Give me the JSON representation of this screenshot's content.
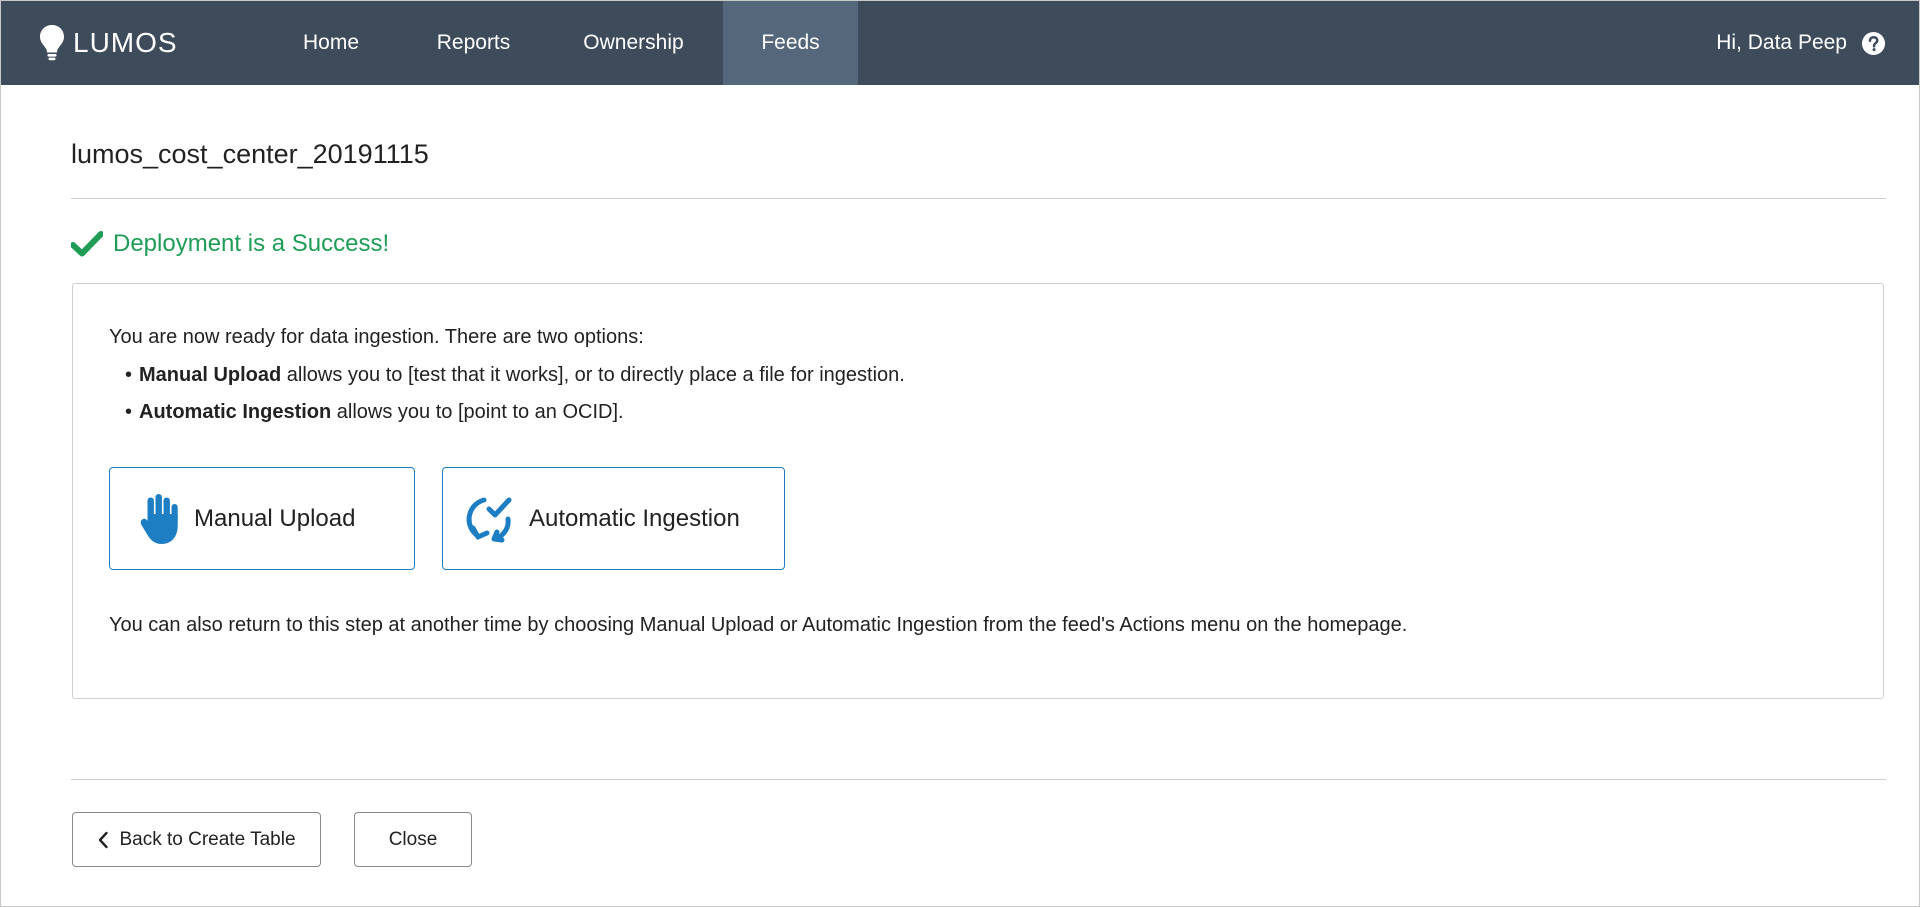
{
  "app": {
    "brand": "LUMOS",
    "greeting": "Hi, Data Peep"
  },
  "nav": {
    "items": [
      {
        "label": "Home",
        "active": false
      },
      {
        "label": "Reports",
        "active": false
      },
      {
        "label": "Ownership",
        "active": false
      },
      {
        "label": "Feeds",
        "active": true
      }
    ]
  },
  "page": {
    "title": "lumos_cost_center_20191115",
    "status": "Deployment is a Success!"
  },
  "panel": {
    "intro": "You are now ready for data ingestion. There are two options:",
    "bullets": [
      {
        "bold": "Manual Upload",
        "text": " allows you to [test that it works], or to directly place a file for ingestion."
      },
      {
        "bold": "Automatic Ingestion",
        "text": " allows you to [point to an OCID]."
      }
    ],
    "options": [
      {
        "label": "Manual Upload",
        "icon": "hand-icon"
      },
      {
        "label": "Automatic Ingestion",
        "icon": "sync-check-icon"
      }
    ],
    "footnote": "You can also return to this step at another time by choosing Manual Upload or Automatic Ingestion from the feed's Actions menu on the homepage."
  },
  "footer": {
    "back_label": "Back to Create Table",
    "close_label": "Close"
  },
  "colors": {
    "nav_bg": "#3d4b5a",
    "nav_active": "#55677a",
    "success_green": "#1f9d57",
    "accent_blue": "#1e7ec4"
  }
}
